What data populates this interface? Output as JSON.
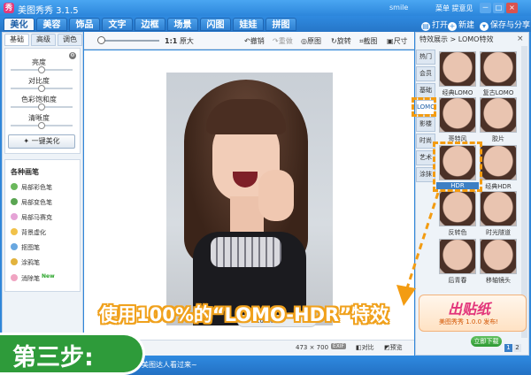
{
  "titlebar": {
    "logo": "秀",
    "title": "美图秀秀 3.1.5",
    "user": "smile",
    "menu": "菜单  提意见",
    "controls": [
      "－",
      "□",
      "×"
    ]
  },
  "tabs": [
    "美化",
    "美容",
    "饰品",
    "文字",
    "边框",
    "场景",
    "闪图",
    "娃娃",
    "拼图"
  ],
  "top_actions": {
    "open": "打开",
    "new": "新建",
    "save": "保存与分享"
  },
  "left": {
    "subtabs": [
      "基础",
      "高级",
      "调色"
    ],
    "sliders": [
      {
        "label": "亮度",
        "value": 0.5
      },
      {
        "label": "对比度",
        "value": 0.5
      },
      {
        "label": "色彩饱和度",
        "value": 0.5
      },
      {
        "label": "清晰度",
        "value": 0.5
      }
    ],
    "beautify": "一键美化",
    "brushes_title": "各种画笔",
    "brushes": [
      {
        "label": "局部彩色笔",
        "color": "#6bb85c"
      },
      {
        "label": "局部变色笔",
        "color": "#5aa552"
      },
      {
        "label": "局部马赛克",
        "color": "#e5a3d6"
      },
      {
        "label": "背景虚化",
        "color": "#f1c24a"
      },
      {
        "label": "抠图笔",
        "color": "#68a7e0"
      },
      {
        "label": "涂鸦笔",
        "color": "#e2b33e"
      },
      {
        "label": "消除笔",
        "color": "#f0a4c2"
      }
    ],
    "new_badge": "New"
  },
  "toolbar": {
    "zoom_value": "1:1",
    "original_size": "原大",
    "undo": "撤销",
    "redo": "重做",
    "original": "原图",
    "rotate": "旋转",
    "crop": "截图",
    "size": "尺寸"
  },
  "canvas": {
    "zoom_readout": "100%",
    "dimensions": "473 × 700",
    "exif": "EXIF",
    "compare": "对比",
    "preview": "预览"
  },
  "right": {
    "header": "特效展示 > LOMO特效",
    "close": "×",
    "categories": [
      "热门",
      "会员",
      "基础",
      "LOMO",
      "影楼",
      "时尚",
      "艺术",
      "涂抹"
    ],
    "active_category": 3,
    "effects": [
      "经典LOMO",
      "复古LOMO",
      "哥特风",
      "胶片",
      "HDR",
      "经典HDR",
      "反转色",
      "时光隧道",
      "后青春",
      "移轴镜头"
    ],
    "selected_effect": "HDR",
    "promo_main": "出贴纸",
    "promo_sub": "美图秀秀 1.0.0 发布!",
    "promo_button": "立即下载",
    "pages": [
      "1",
      "2"
    ]
  },
  "bottom": {
    "message": "美图达人看过来~"
  },
  "overlay": {
    "caption": "使用100%的“LOMO-HDR”特效",
    "step": "第三步:",
    "highlight_color": "#f39c12"
  }
}
